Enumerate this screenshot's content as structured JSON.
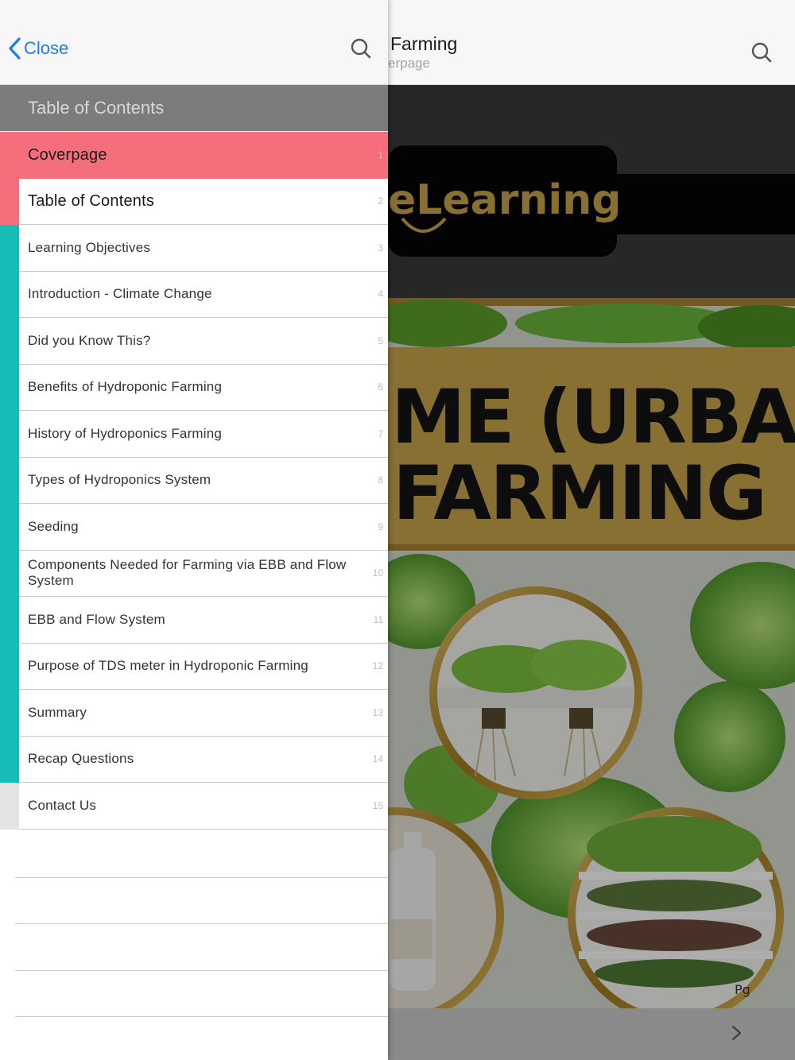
{
  "nav": {
    "close_label": "Close",
    "doc_title": "Farming",
    "doc_subtitle": "erpage"
  },
  "toc": {
    "header": "Table of Contents",
    "items": [
      {
        "label": "Coverpage",
        "page": "1",
        "state": "active"
      },
      {
        "label": "Table of Contents",
        "page": "2",
        "state": "current"
      },
      {
        "label": "Learning Objectives",
        "page": "3",
        "state": "teal"
      },
      {
        "label": "Introduction - Climate Change",
        "page": "4",
        "state": "teal"
      },
      {
        "label": "Did you Know This?",
        "page": "5",
        "state": "teal"
      },
      {
        "label": "Benefits of Hydroponic Farming",
        "page": "6",
        "state": "teal"
      },
      {
        "label": "History of Hydroponics Farming",
        "page": "7",
        "state": "teal"
      },
      {
        "label": "Types of Hydroponics System",
        "page": "8",
        "state": "teal"
      },
      {
        "label": "Seeding",
        "page": "9",
        "state": "teal"
      },
      {
        "label": "Components Needed for Farming via EBB and Flow System",
        "page": "10",
        "state": "teal"
      },
      {
        "label": "EBB and Flow System",
        "page": "11",
        "state": "teal"
      },
      {
        "label": "Purpose of TDS meter in Hydroponic Farming",
        "page": "12",
        "state": "teal"
      },
      {
        "label": "Summary",
        "page": "13",
        "state": "teal"
      },
      {
        "label": "Recap Questions",
        "page": "14",
        "state": "teal"
      },
      {
        "label": "Contact Us",
        "page": "15",
        "state": "gray"
      }
    ]
  },
  "cover": {
    "logo_text": "eLearning",
    "title_line1": "ME (URBAN)",
    "title_line2": "FARMING",
    "footer_mark": "Pg"
  },
  "icons": {
    "back": "chevron-left-icon",
    "search": "search-icon",
    "next": "chevron-right-icon"
  },
  "colors": {
    "accent_blue": "#1a7de8",
    "active_row": "#f56e7c",
    "teal_bar": "#17bcb6",
    "toc_header_bg": "#7c7c7c",
    "cover_gold": "#c9a44a"
  }
}
